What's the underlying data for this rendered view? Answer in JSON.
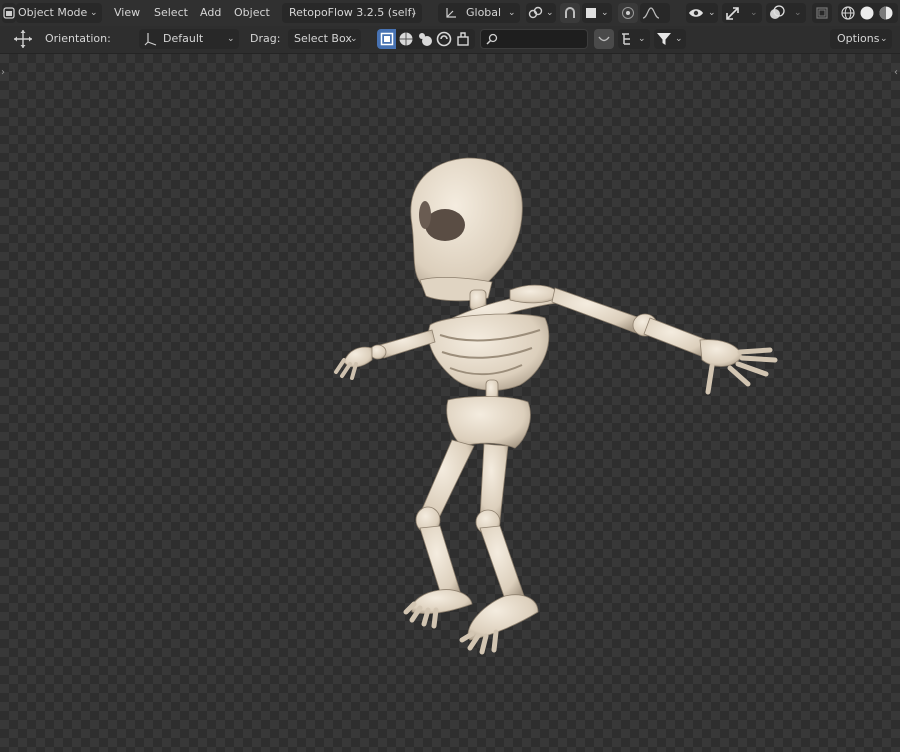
{
  "header": {
    "mode": "Object Mode",
    "menu": [
      "View",
      "Select",
      "Add",
      "Object"
    ],
    "addon": "RetopoFlow 3.2.5 (self)",
    "transform_orientation": "Global"
  },
  "toolbar": {
    "orientation_label": "Orientation:",
    "orientation_value": "Default",
    "drag_label": "Drag:",
    "drag_value": "Select Box",
    "search_placeholder": "",
    "options_label": "Options"
  },
  "colors": {
    "header_bg": "#303030",
    "active_blue": "#4772b3",
    "viewport_checker_light": "#383838",
    "viewport_checker_dark": "#2e2e2e",
    "bone": "#e8dccb"
  },
  "icons": [
    "blender-editor-icon",
    "orientation-axes-icon",
    "link-snap-icon",
    "magnet-icon",
    "proportional-edit-icon",
    "falloff-curve-icon",
    "visibility-eye-icon",
    "gizmo-icon",
    "overlay-icon",
    "xray-icon",
    "wireframe-shading-icon",
    "solid-shading-icon",
    "material-shading-icon",
    "move-gizmo-icon",
    "select-mode-icons",
    "search-icon",
    "filter-icon"
  ]
}
